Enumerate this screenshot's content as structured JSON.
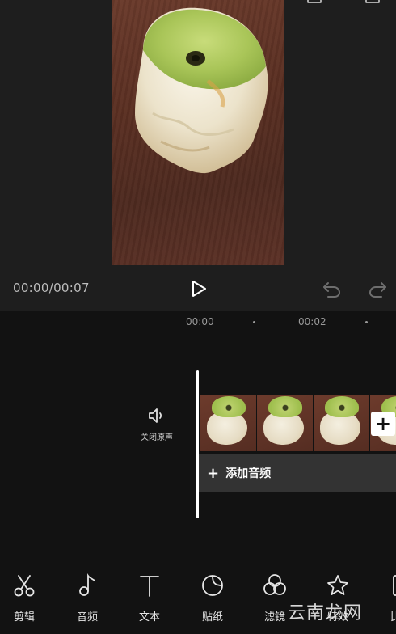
{
  "player": {
    "time": "00:00/00:07",
    "accent_color": "#ffffff"
  },
  "ruler": {
    "ticks": [
      "00:00",
      "00:02"
    ]
  },
  "track": {
    "mute_label": "关闭原声",
    "add_audio_label": "添加音频",
    "add_audio_plus": "+"
  },
  "toolbar": {
    "items": [
      {
        "label": "剪辑",
        "icon": "scissors-icon"
      },
      {
        "label": "音频",
        "icon": "music-note-icon"
      },
      {
        "label": "文本",
        "icon": "text-icon"
      },
      {
        "label": "贴纸",
        "icon": "sticker-icon"
      },
      {
        "label": "滤镜",
        "icon": "filter-icon"
      },
      {
        "label": "特效",
        "icon": "effects-star-icon"
      },
      {
        "label": "比",
        "icon": "ratio-icon"
      }
    ]
  },
  "watermark": {
    "text": "云南龙网"
  }
}
